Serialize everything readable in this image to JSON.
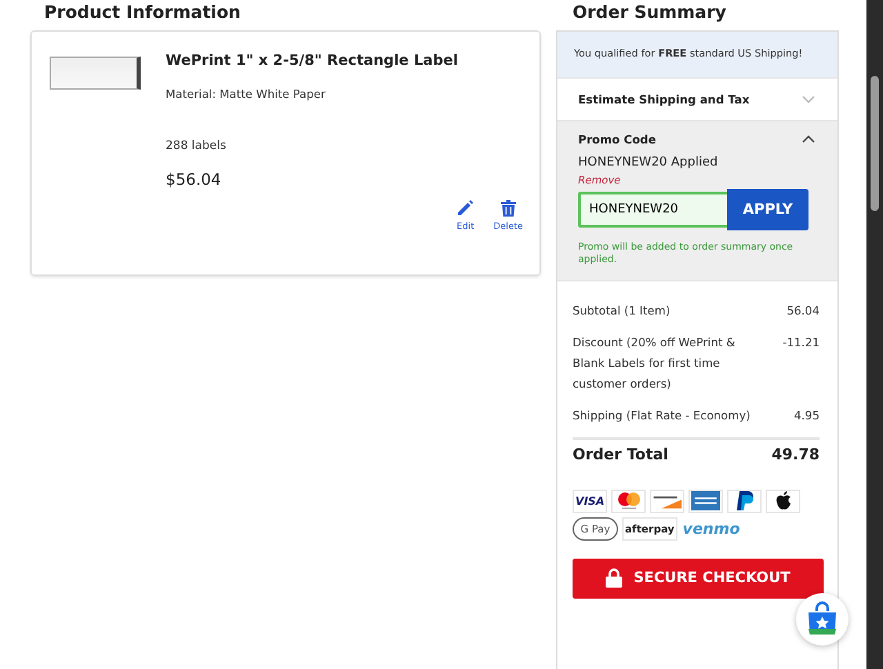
{
  "product_section": {
    "title": "Product Information",
    "item": {
      "name": "WePrint 1\" x 2-5/8\" Rectangle Label",
      "material": "Material: Matte White Paper",
      "quantity": "288 labels",
      "price": "$56.04",
      "actions": [
        {
          "kind": "edit",
          "label": "Edit"
        },
        {
          "kind": "delete",
          "label": "Delete"
        }
      ]
    }
  },
  "order_summary": {
    "title": "Order Summary",
    "shipping_notice": "You qualified for **FREE** standard US Shipping!",
    "sections": [
      {
        "label": "Estimate Shipping and Tax",
        "expanded": false
      },
      {
        "label": "Promo Code",
        "expanded": true
      }
    ],
    "promo": {
      "applied": "HONEYNEW20 Applied",
      "remove": "Remove",
      "code": "HONEYNEW20",
      "button": "APPLY",
      "note": "Promo will be added to order summary once applied."
    },
    "lines": [
      {
        "label": "Subtotal (1 Item)",
        "amount": "56.04"
      },
      {
        "label": "Discount (20% off WePrint & Blank Labels for first time customer orders)",
        "amount": "-11.21"
      },
      {
        "label": "Shipping (Flat Rate - Economy)",
        "amount": "4.95"
      }
    ],
    "total": {
      "label": "Order Total",
      "amount": "49.78"
    },
    "payment_labels": [
      "VISA",
      "G Pay",
      "afterpay",
      "venmo"
    ],
    "checkout_button": "SECURE CHECKOUT"
  }
}
